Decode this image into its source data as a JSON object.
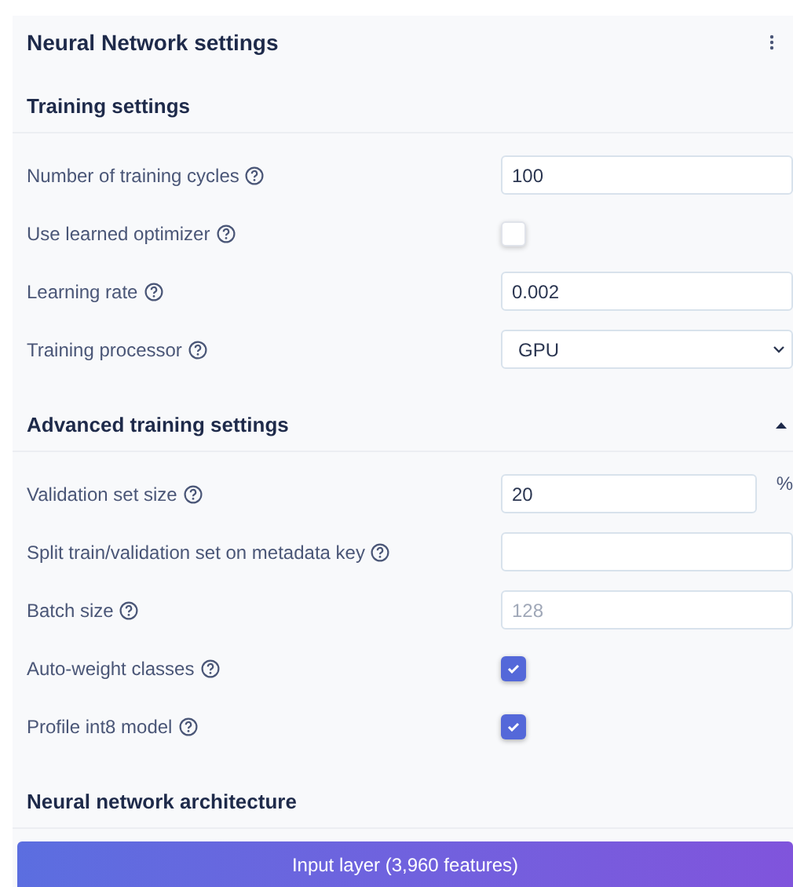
{
  "panel": {
    "title": "Neural Network settings"
  },
  "sections": [
    {
      "title": "Training settings",
      "rows": [
        {
          "kind": "input",
          "label": "Number of training cycles",
          "value": "100"
        },
        {
          "kind": "checkbox",
          "label": "Use learned optimizer",
          "checked": false
        },
        {
          "kind": "input",
          "label": "Learning rate",
          "value": "0.002"
        },
        {
          "kind": "select",
          "label": "Training processor",
          "value": "GPU"
        }
      ]
    },
    {
      "title": "Advanced training settings",
      "expanded": true,
      "rows": [
        {
          "kind": "input",
          "label": "Validation set size",
          "value": "20",
          "suffix": "%"
        },
        {
          "kind": "input",
          "label": "Split train/validation set on metadata key"
        },
        {
          "kind": "input",
          "label": "Batch size",
          "placeholder": "128"
        },
        {
          "kind": "checkbox",
          "label": "Auto-weight classes",
          "checked": true
        },
        {
          "kind": "checkbox",
          "label": "Profile int8 model",
          "checked": true
        }
      ]
    },
    {
      "title": "Neural network architecture"
    }
  ],
  "input_layer": {
    "label": "Input layer (3,960 features)"
  }
}
